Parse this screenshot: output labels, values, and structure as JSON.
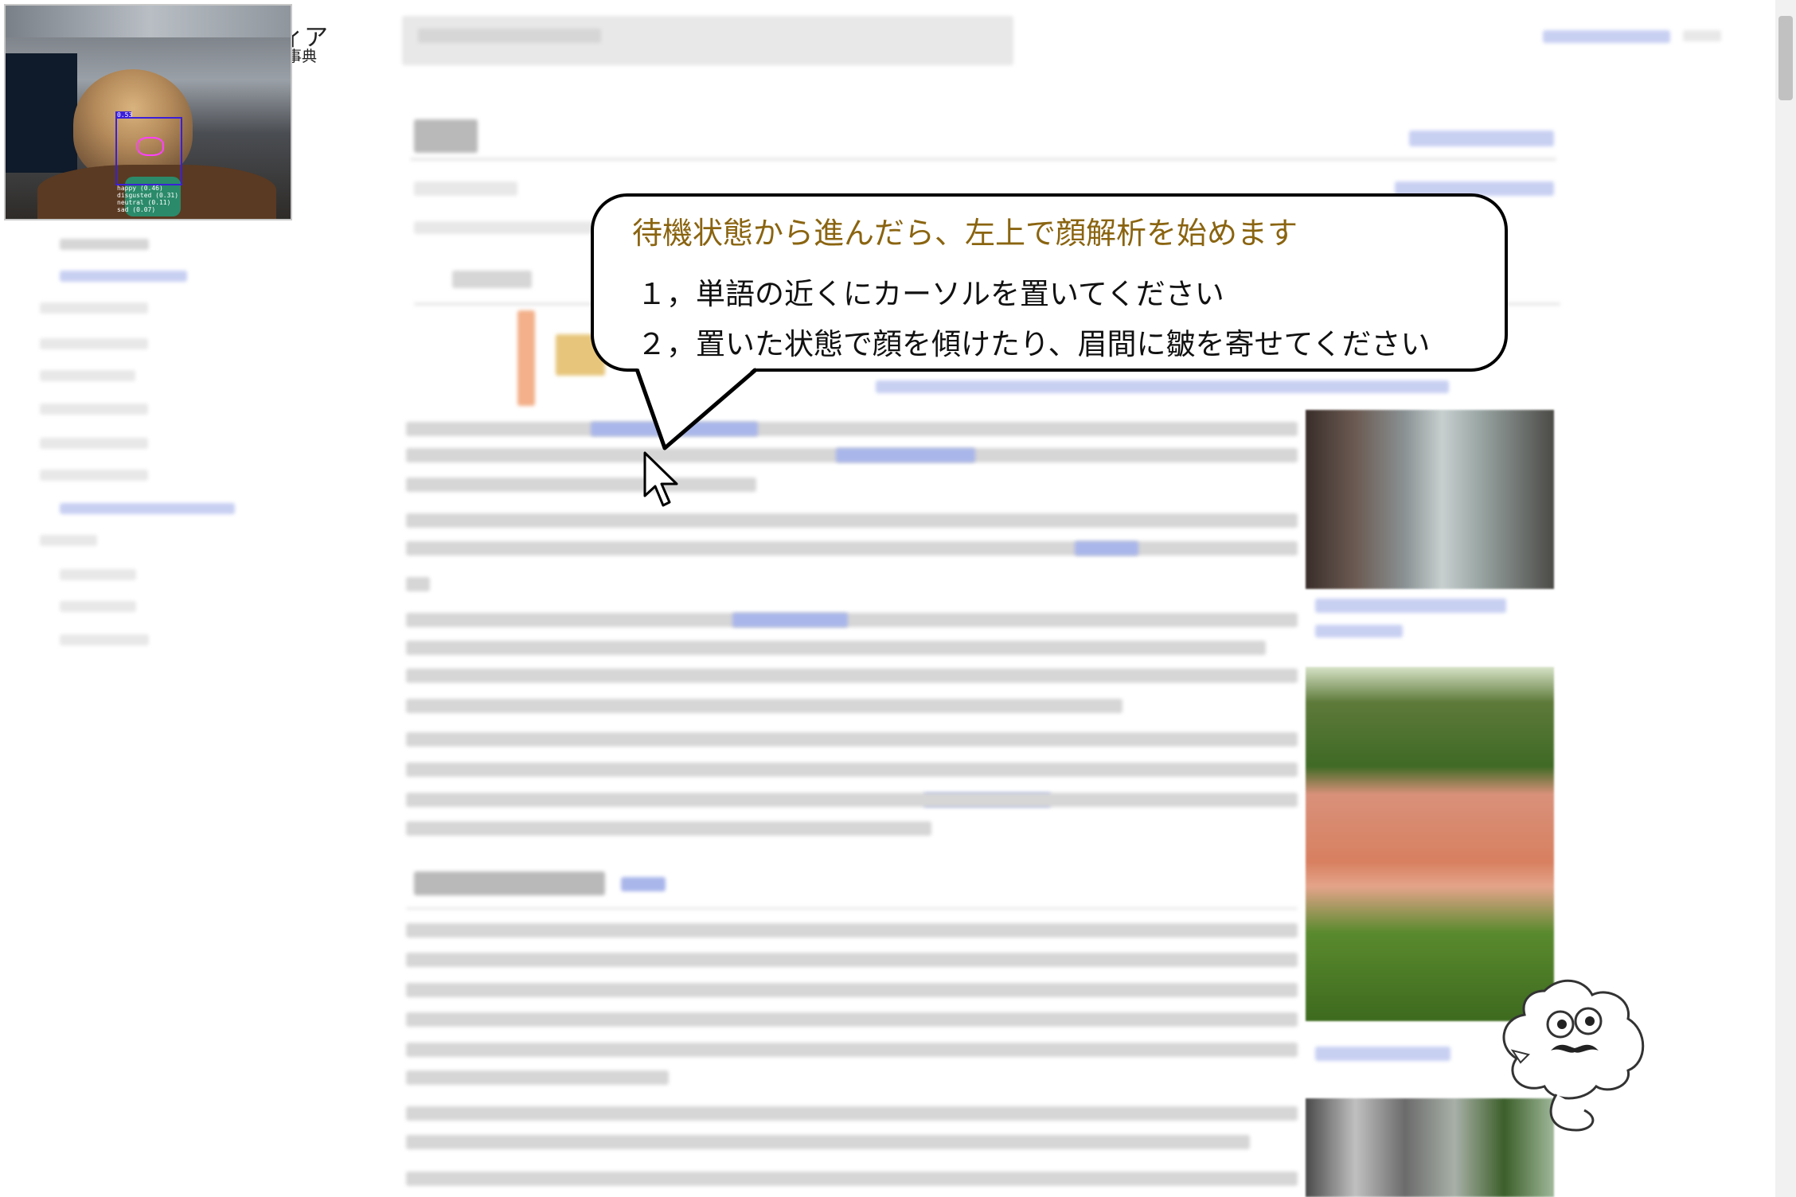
{
  "site": {
    "title": "ィア",
    "subtitle": "事典"
  },
  "webcam": {
    "tag": "0.53",
    "emotions": [
      "happy (0.46)",
      "disgusted (0.31)",
      "neutral (0.11)",
      "sad (0.07)"
    ]
  },
  "bubble": {
    "title": "待機状態から進んだら、左上で顔解析を始めます",
    "line1": "１，単語の近くにカーソルを置いてください",
    "line2": "２，置いた状態で顔を傾けたり、眉間に皺を寄せてください"
  },
  "colors": {
    "accent_text": "#8a6410",
    "link_blue": "#3366cc",
    "webcam_box": "#3b1fd8"
  },
  "icons": [
    "mouse-cursor-icon",
    "mascot-character-icon"
  ]
}
